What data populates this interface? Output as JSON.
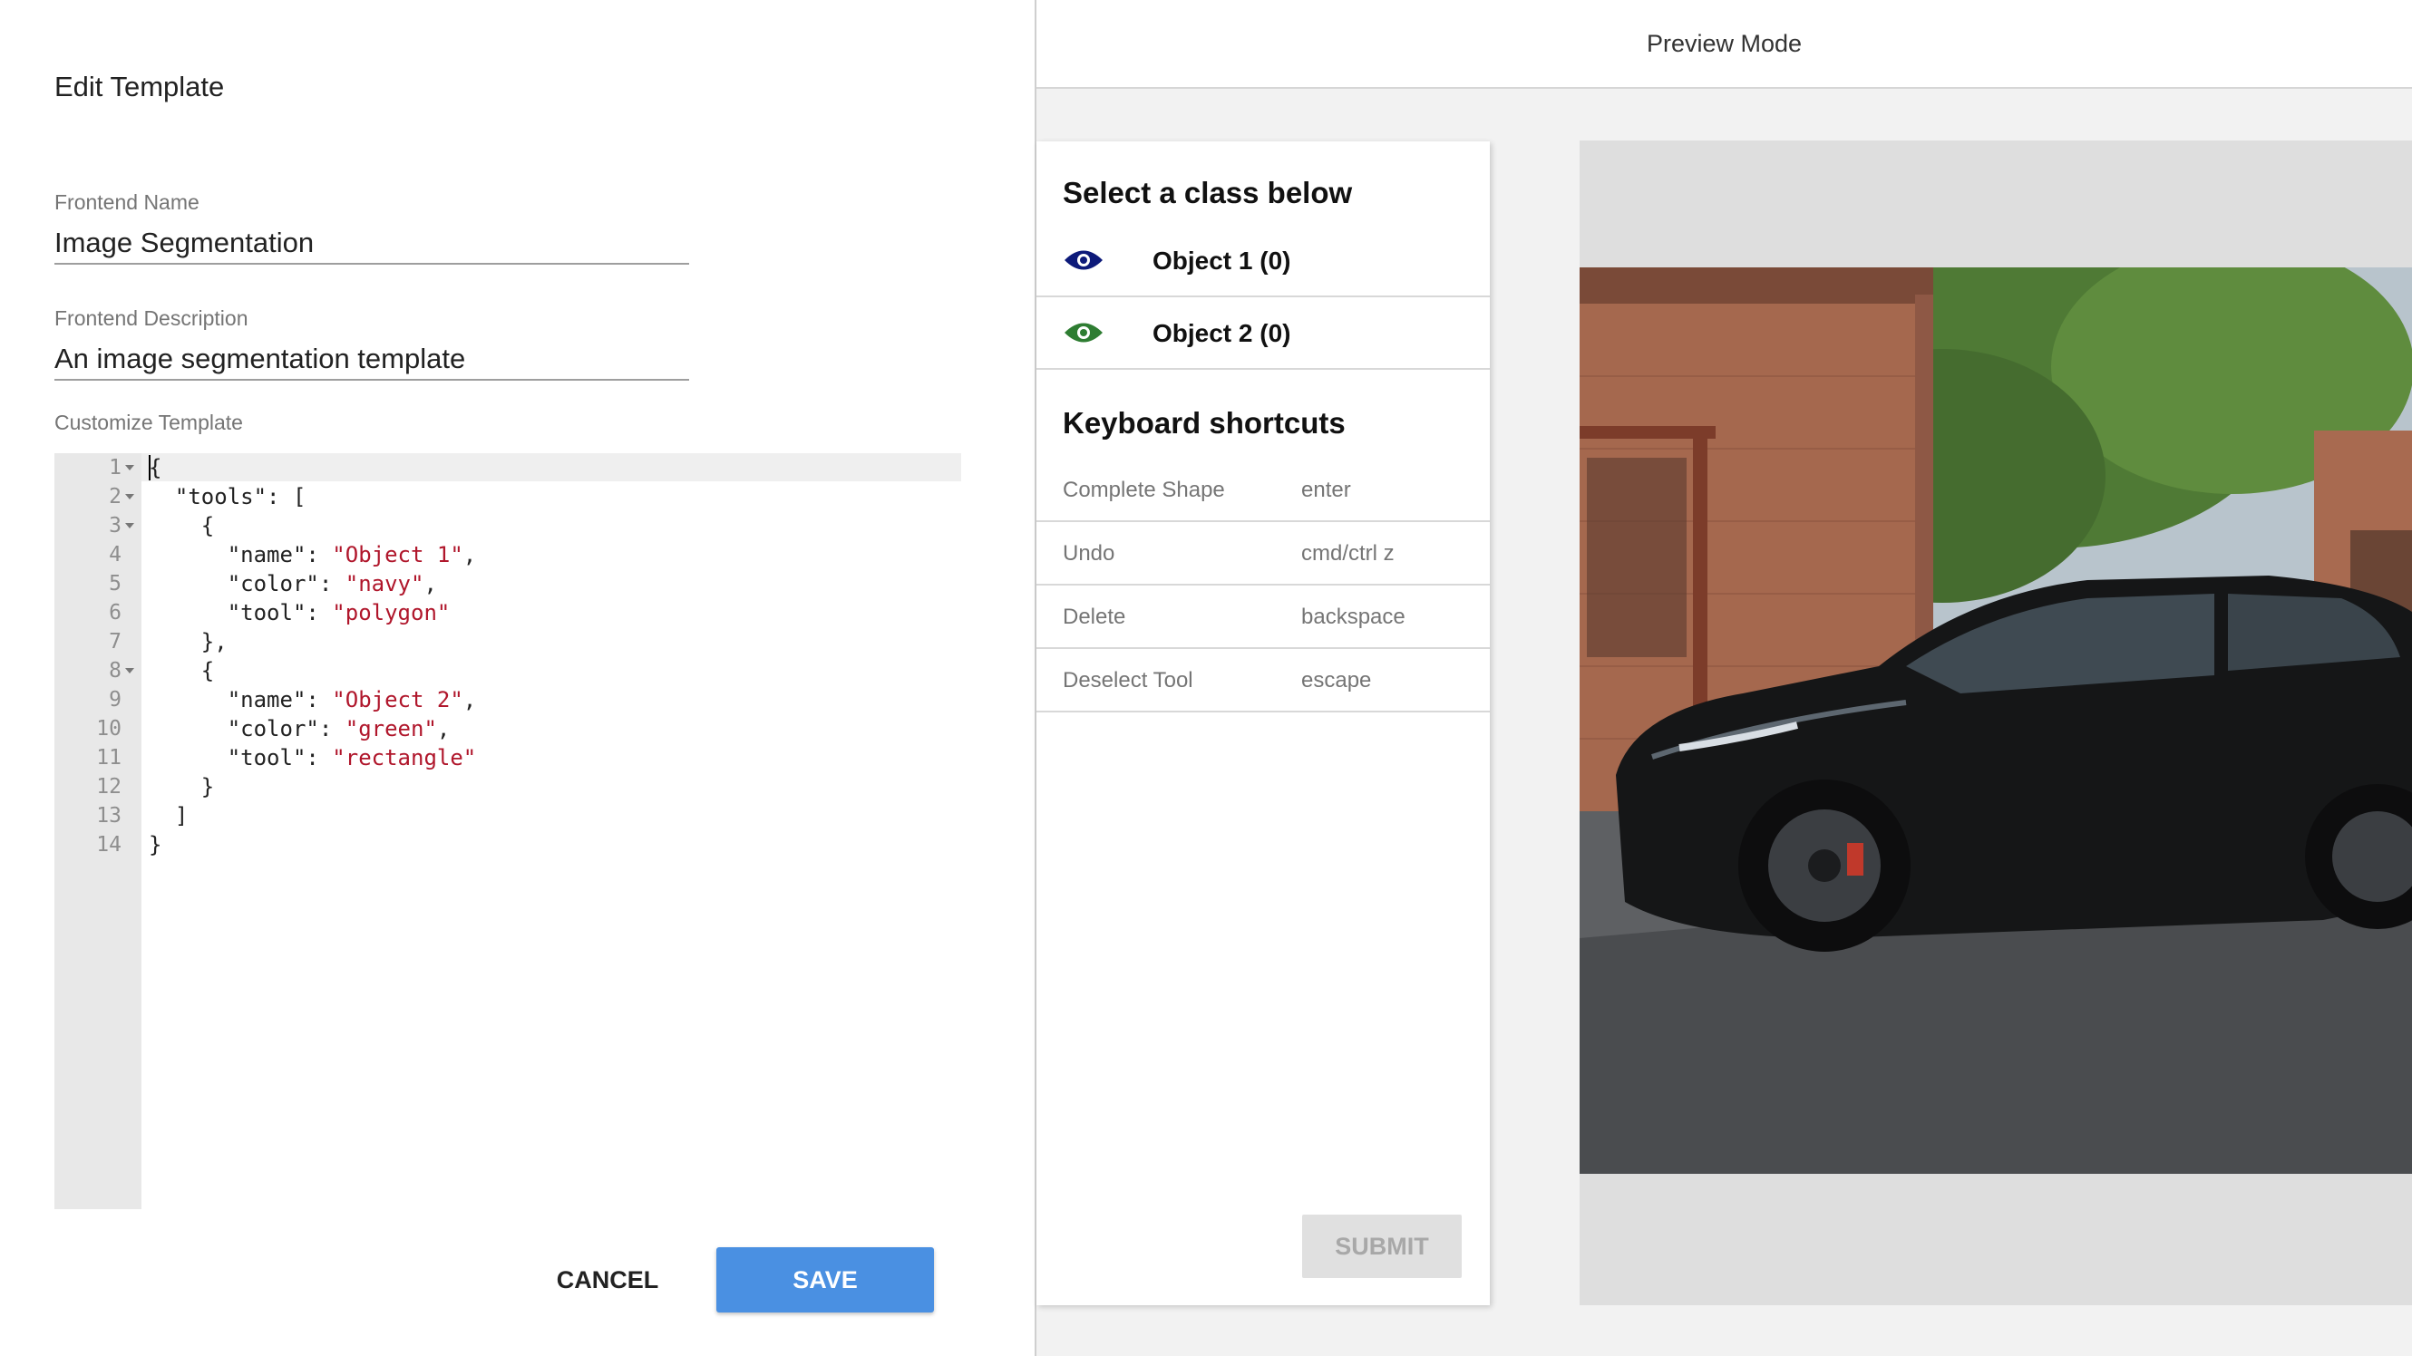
{
  "editor_panel": {
    "title": "Edit Template",
    "frontend_name": {
      "label": "Frontend Name",
      "value": "Image Segmentation"
    },
    "frontend_description": {
      "label": "Frontend Description",
      "value": "An image segmentation template"
    },
    "customize_label": "Customize Template",
    "line_numbers": [
      "1",
      "2",
      "3",
      "4",
      "5",
      "6",
      "7",
      "8",
      "9",
      "10",
      "11",
      "12",
      "13",
      "14"
    ],
    "cancel_label": "CANCEL",
    "save_label": "SAVE"
  },
  "preview": {
    "title": "Preview Mode",
    "select_heading": "Select a class below",
    "classes": [
      {
        "label": "Object 1",
        "count": "(0)",
        "color": "#0d1a7a"
      },
      {
        "label": "Object 2",
        "count": "(0)",
        "color": "#2e7d32"
      }
    ],
    "shortcuts_heading": "Keyboard shortcuts",
    "shortcuts": [
      {
        "action": "Complete Shape",
        "key": "enter"
      },
      {
        "action": "Undo",
        "key": "cmd/ctrl z"
      },
      {
        "action": "Delete",
        "key": "backspace"
      },
      {
        "action": "Deselect Tool",
        "key": "escape"
      }
    ],
    "submit_label": "SUBMIT"
  },
  "colors": {
    "accent": "#4a90e2",
    "string": "#b0162b"
  }
}
